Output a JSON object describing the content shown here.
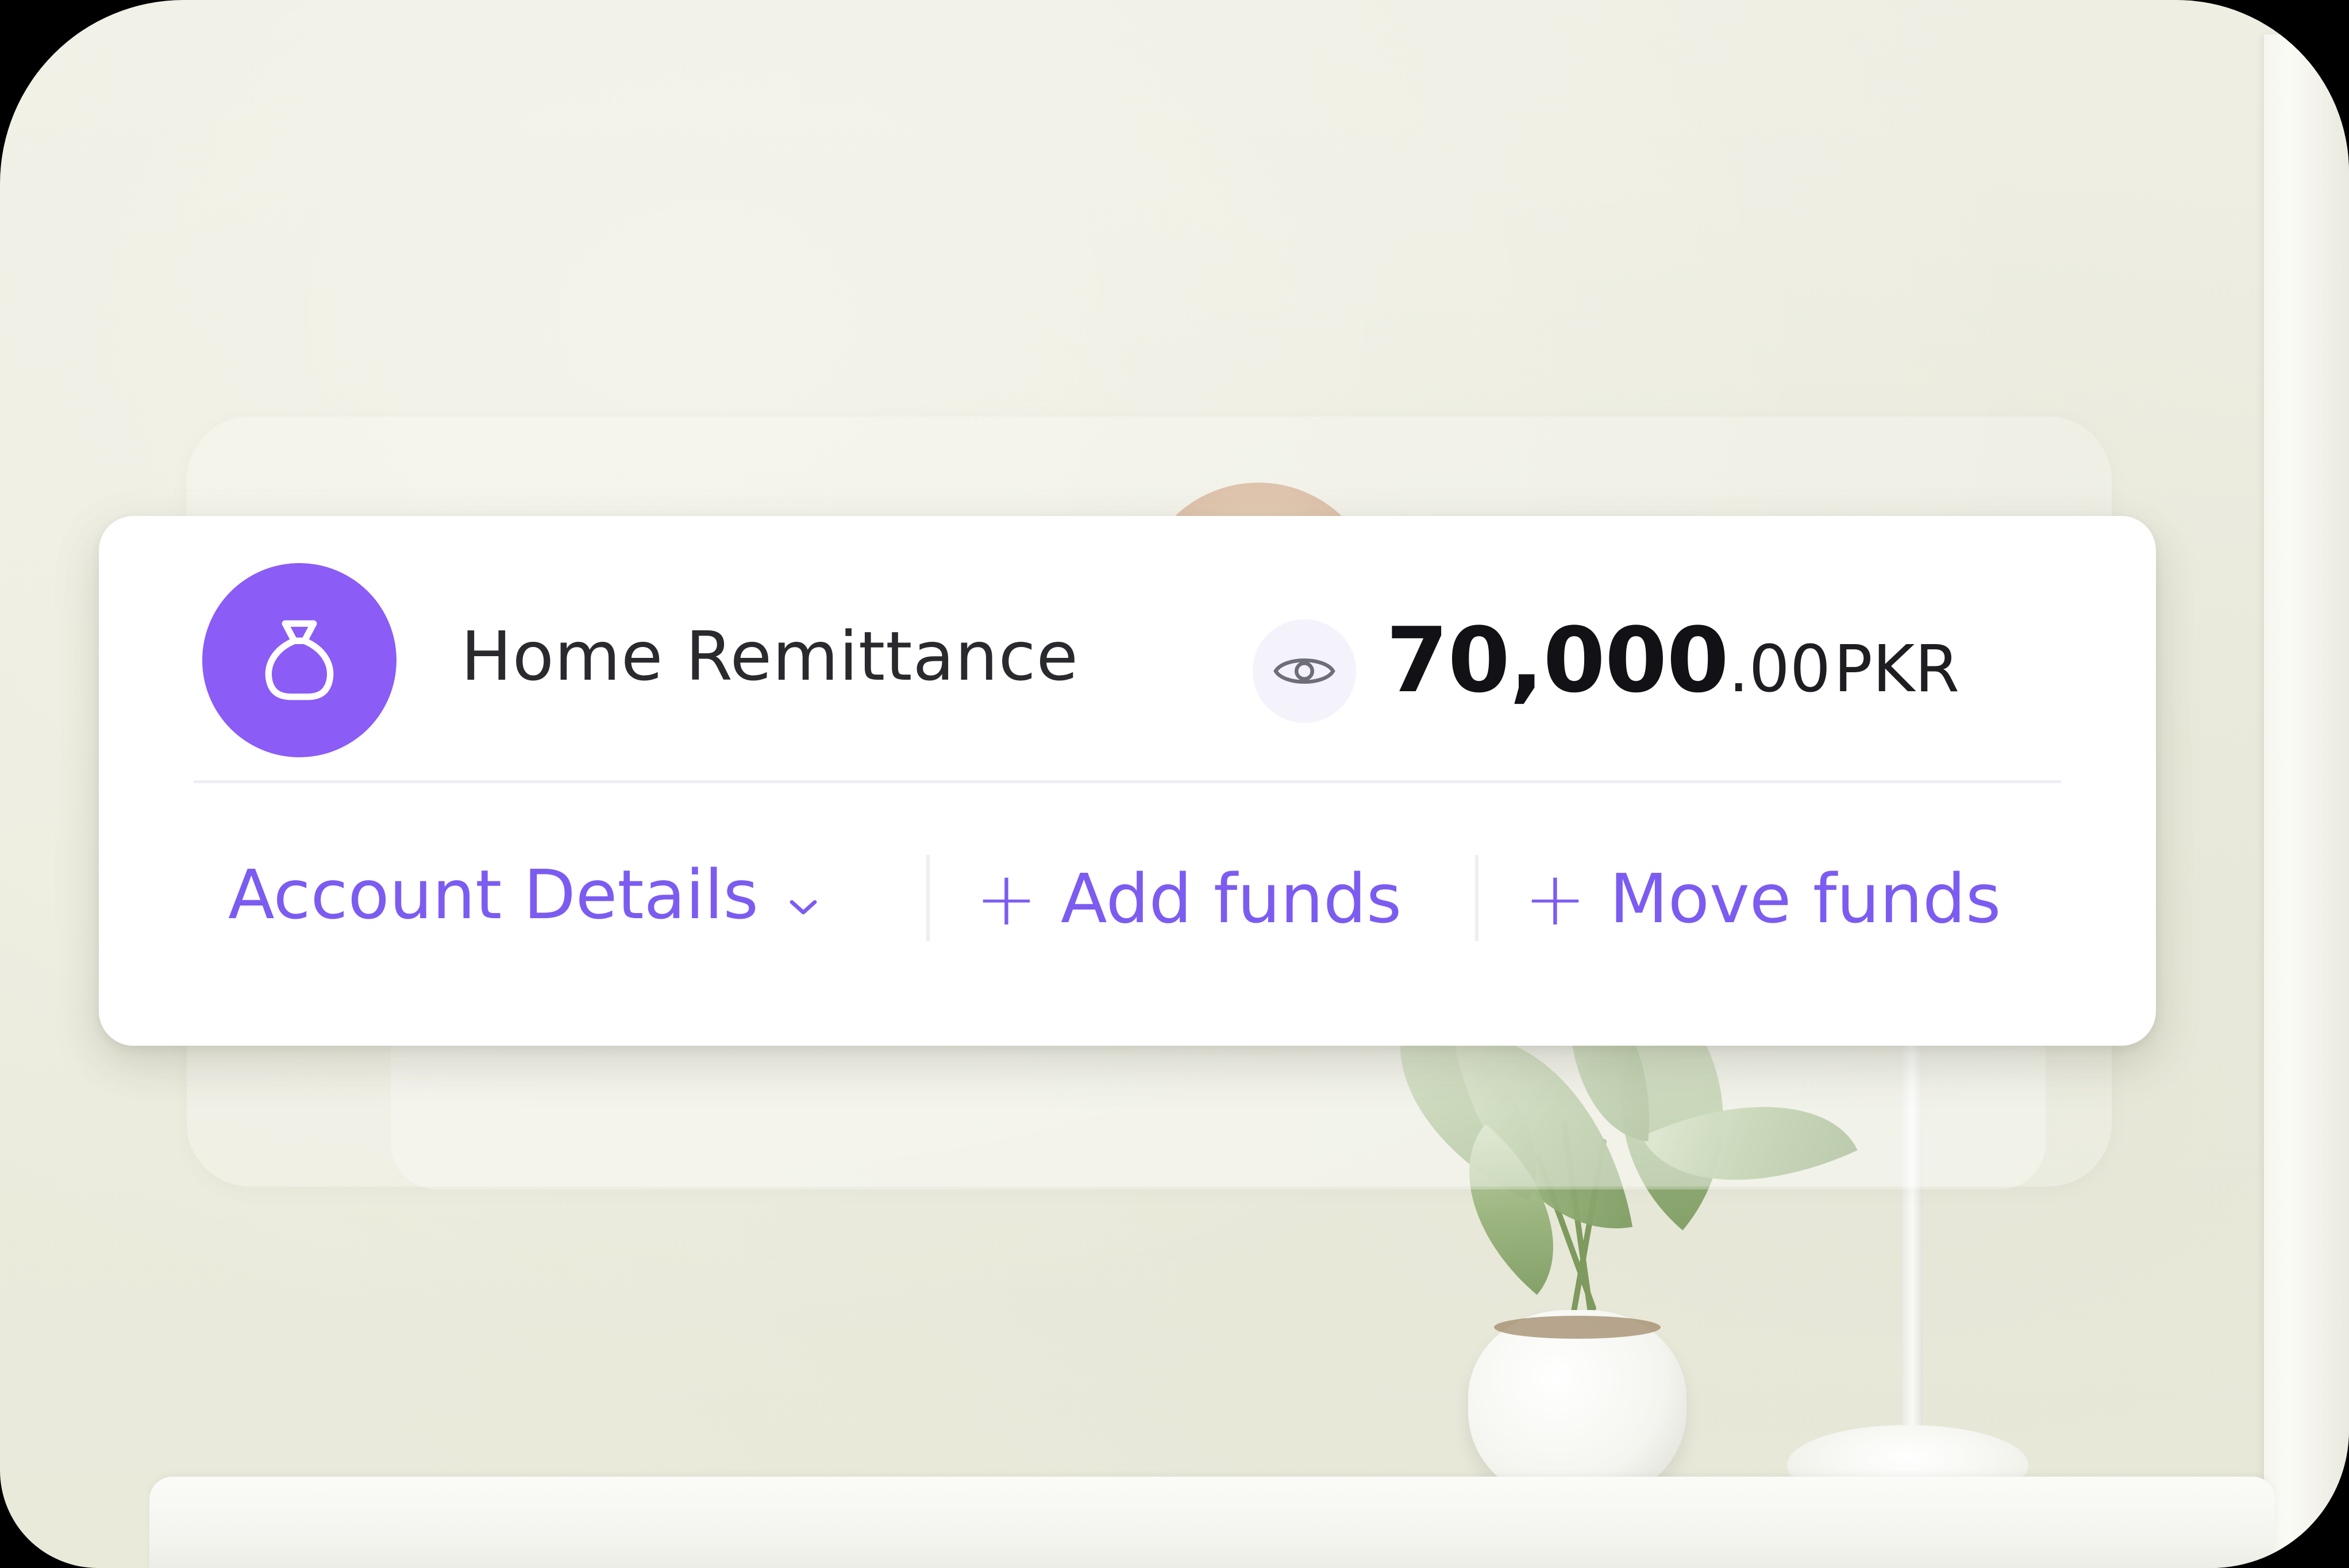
{
  "colors": {
    "accent": "#7c5cf0",
    "avatar_bg": "#8b5cf6",
    "card_bg": "#ffffff",
    "text_primary": "#2a2a2e",
    "balance_text": "#121216"
  },
  "account": {
    "icon": "money-bag-icon",
    "name": "Home Remittance",
    "visibility_icon": "eye-icon",
    "balance": {
      "main": "70,000",
      "decimal": ".00",
      "currency": "PKR"
    }
  },
  "actions": {
    "details": {
      "label": "Account Details",
      "icon": "chevron-down-icon"
    },
    "add_funds": {
      "icon": "plus-icon",
      "plus": "+",
      "label": "Add funds"
    },
    "move_funds": {
      "icon": "plus-icon",
      "plus": "+",
      "label": "Move funds"
    }
  }
}
